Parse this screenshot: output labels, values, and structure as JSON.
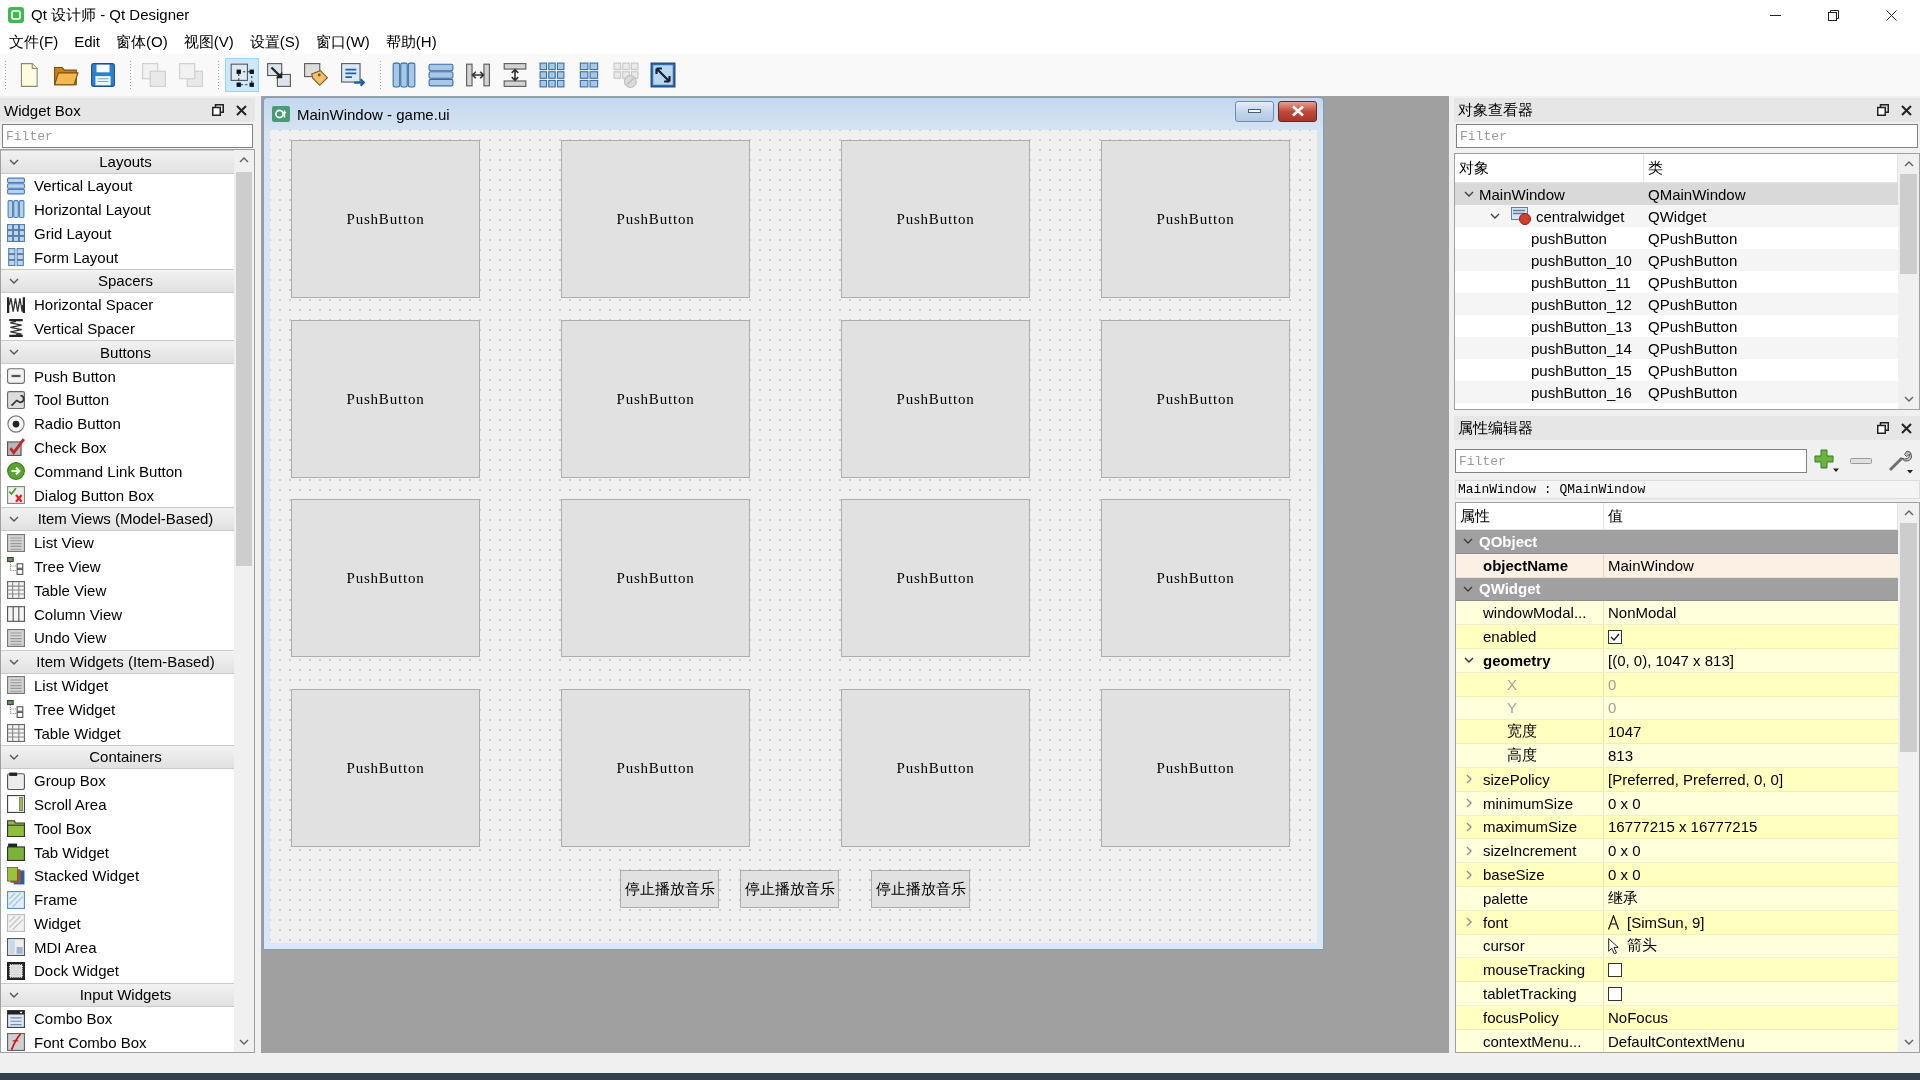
{
  "window": {
    "title": "Qt 设计师 - Qt Designer"
  },
  "menu": [
    {
      "label": "文件(F)"
    },
    {
      "label": "Edit"
    },
    {
      "label": "窗体(O)"
    },
    {
      "label": "视图(V)"
    },
    {
      "label": "设置(S)"
    },
    {
      "label": "窗口(W)"
    },
    {
      "label": "帮助(H)"
    }
  ],
  "toolbar": {
    "groups": [
      {
        "tools": [
          {
            "selected": false,
            "disabled": false
          },
          {
            "selected": false,
            "disabled": false
          },
          {
            "selected": false,
            "disabled": false
          }
        ]
      },
      {
        "tools": [
          {
            "selected": false,
            "disabled": true
          },
          {
            "selected": false,
            "disabled": true
          }
        ]
      },
      {
        "tools": [
          {
            "selected": true,
            "disabled": false
          },
          {
            "selected": false,
            "disabled": false
          },
          {
            "selected": false,
            "disabled": false
          },
          {
            "selected": false,
            "disabled": false
          }
        ]
      },
      {
        "tools": [
          {
            "selected": false,
            "disabled": false
          },
          {
            "selected": false,
            "disabled": false
          },
          {
            "selected": false,
            "disabled": false
          },
          {
            "selected": false,
            "disabled": false
          },
          {
            "selected": false,
            "disabled": false
          },
          {
            "selected": false,
            "disabled": false
          },
          {
            "selected": false,
            "disabled": true
          },
          {
            "selected": false,
            "disabled": false
          }
        ]
      }
    ]
  },
  "widget_box": {
    "title": "Widget Box",
    "filter": {
      "placeholder": "Filter"
    },
    "sections": [
      {
        "title": "Layouts",
        "expanded": true,
        "items": [
          {
            "label": "Vertical Layout"
          },
          {
            "label": "Horizontal Layout"
          },
          {
            "label": "Grid Layout"
          },
          {
            "label": "Form Layout"
          }
        ]
      },
      {
        "title": "Spacers",
        "expanded": true,
        "items": [
          {
            "label": "Horizontal Spacer"
          },
          {
            "label": "Vertical Spacer"
          }
        ]
      },
      {
        "title": "Buttons",
        "expanded": true,
        "items": [
          {
            "label": "Push Button"
          },
          {
            "label": "Tool Button"
          },
          {
            "label": "Radio Button"
          },
          {
            "label": "Check Box"
          },
          {
            "label": "Command Link Button"
          },
          {
            "label": "Dialog Button Box"
          }
        ]
      },
      {
        "title": "Item Views (Model-Based)",
        "expanded": true,
        "items": [
          {
            "label": "List View"
          },
          {
            "label": "Tree View"
          },
          {
            "label": "Table View"
          },
          {
            "label": "Column View"
          },
          {
            "label": "Undo View"
          }
        ]
      },
      {
        "title": "Item Widgets (Item-Based)",
        "expanded": true,
        "items": [
          {
            "label": "List Widget"
          },
          {
            "label": "Tree Widget"
          },
          {
            "label": "Table Widget"
          }
        ]
      },
      {
        "title": "Containers",
        "expanded": true,
        "items": [
          {
            "label": "Group Box"
          },
          {
            "label": "Scroll Area"
          },
          {
            "label": "Tool Box"
          },
          {
            "label": "Tab Widget"
          },
          {
            "label": "Stacked Widget"
          },
          {
            "label": "Frame"
          },
          {
            "label": "Widget"
          },
          {
            "label": "MDI Area"
          },
          {
            "label": "Dock Widget"
          }
        ]
      },
      {
        "title": "Input Widgets",
        "expanded": true,
        "items": [
          {
            "label": "Combo Box"
          },
          {
            "label": "Font Combo Box"
          }
        ]
      }
    ]
  },
  "form_window": {
    "title": "MainWindow - game.ui",
    "grid_buttons": [
      {
        "label": "PushButton"
      },
      {
        "label": "PushButton"
      },
      {
        "label": "PushButton"
      },
      {
        "label": "PushButton"
      },
      {
        "label": "PushButton"
      },
      {
        "label": "PushButton"
      },
      {
        "label": "PushButton"
      },
      {
        "label": "PushButton"
      },
      {
        "label": "PushButton"
      },
      {
        "label": "PushButton"
      },
      {
        "label": "PushButton"
      },
      {
        "label": "PushButton"
      },
      {
        "label": "PushButton"
      },
      {
        "label": "PushButton"
      },
      {
        "label": "PushButton"
      },
      {
        "label": "PushButton"
      }
    ],
    "bottom_buttons": [
      {
        "label": "停止播放音乐"
      },
      {
        "label": "停止播放音乐"
      },
      {
        "label": "停止播放音乐"
      }
    ]
  },
  "object_inspector": {
    "title": "对象查看器",
    "filter": {
      "placeholder": "Filter"
    },
    "columns": [
      "对象",
      "类"
    ],
    "tree": [
      {
        "object": "MainWindow",
        "class": "QMainWindow",
        "selected": true,
        "expanded": true,
        "children": [
          {
            "object": "centralwidget",
            "class": "QWidget",
            "kind": "container",
            "selected": false,
            "expanded": true,
            "children": [
              {
                "object": "pushButton",
                "class": "QPushButton",
                "selected": false
              },
              {
                "object": "pushButton_10",
                "class": "QPushButton",
                "selected": false
              },
              {
                "object": "pushButton_11",
                "class": "QPushButton",
                "selected": false
              },
              {
                "object": "pushButton_12",
                "class": "QPushButton",
                "selected": false
              },
              {
                "object": "pushButton_13",
                "class": "QPushButton",
                "selected": false
              },
              {
                "object": "pushButton_14",
                "class": "QPushButton",
                "selected": false
              },
              {
                "object": "pushButton_15",
                "class": "QPushButton",
                "selected": false
              },
              {
                "object": "pushButton_16",
                "class": "QPushButton",
                "selected": false
              }
            ]
          }
        ]
      }
    ]
  },
  "property_editor": {
    "title": "属性编辑器",
    "filter": {
      "placeholder": "Filter"
    },
    "context": "MainWindow : QMainWindow",
    "columns": [
      "属性",
      "值"
    ],
    "groups": [
      {
        "name": "QObject",
        "expanded": true,
        "properties": [
          {
            "name": "objectName",
            "value": "MainWindow",
            "kind": "text",
            "changed": true
          }
        ]
      },
      {
        "name": "QWidget",
        "expanded": true,
        "properties": [
          {
            "name": "windowModal...",
            "value": "NonModal",
            "kind": "text",
            "changed": false
          },
          {
            "name": "enabled",
            "kind": "checkbox",
            "checked": true,
            "changed": false
          },
          {
            "name": "geometry",
            "value": "[(0, 0), 1047 x 813]",
            "kind": "text",
            "changed": true,
            "expanded": true,
            "children": [
              {
                "name": "X",
                "value": "0",
                "kind": "text",
                "changed": false,
                "disabled": true
              },
              {
                "name": "Y",
                "value": "0",
                "kind": "text",
                "changed": false,
                "disabled": true
              },
              {
                "name": "宽度",
                "value": "1047",
                "kind": "text",
                "changed": false,
                "disabled": false
              },
              {
                "name": "高度",
                "value": "813",
                "kind": "text",
                "changed": false,
                "disabled": false
              }
            ]
          },
          {
            "name": "sizePolicy",
            "value": "[Preferred, Preferred, 0, 0]",
            "kind": "text",
            "changed": false,
            "expanded": false
          },
          {
            "name": "minimumSize",
            "value": "0 x 0",
            "kind": "text",
            "changed": false,
            "expanded": false
          },
          {
            "name": "maximumSize",
            "value": "16777215 x 16777215",
            "kind": "text",
            "changed": false,
            "expanded": false
          },
          {
            "name": "sizeIncrement",
            "value": "0 x 0",
            "kind": "text",
            "changed": false,
            "expanded": false
          },
          {
            "name": "baseSize",
            "value": "0 x 0",
            "kind": "text",
            "changed": false,
            "expanded": false
          },
          {
            "name": "palette",
            "value": "继承",
            "kind": "text",
            "changed": false
          },
          {
            "name": "font",
            "value": "[SimSun, 9]",
            "kind": "font",
            "changed": false,
            "expanded": false
          },
          {
            "name": "cursor",
            "value": "箭头",
            "kind": "cursor",
            "changed": false
          },
          {
            "name": "mouseTracking",
            "kind": "checkbox",
            "checked": false,
            "changed": false
          },
          {
            "name": "tabletTracking",
            "kind": "checkbox",
            "checked": false,
            "changed": false
          },
          {
            "name": "focusPolicy",
            "value": "NoFocus",
            "kind": "text",
            "changed": false
          },
          {
            "name": "contextMenu...",
            "value": "DefaultContextMenu",
            "kind": "text",
            "changed": false
          }
        ]
      }
    ]
  }
}
